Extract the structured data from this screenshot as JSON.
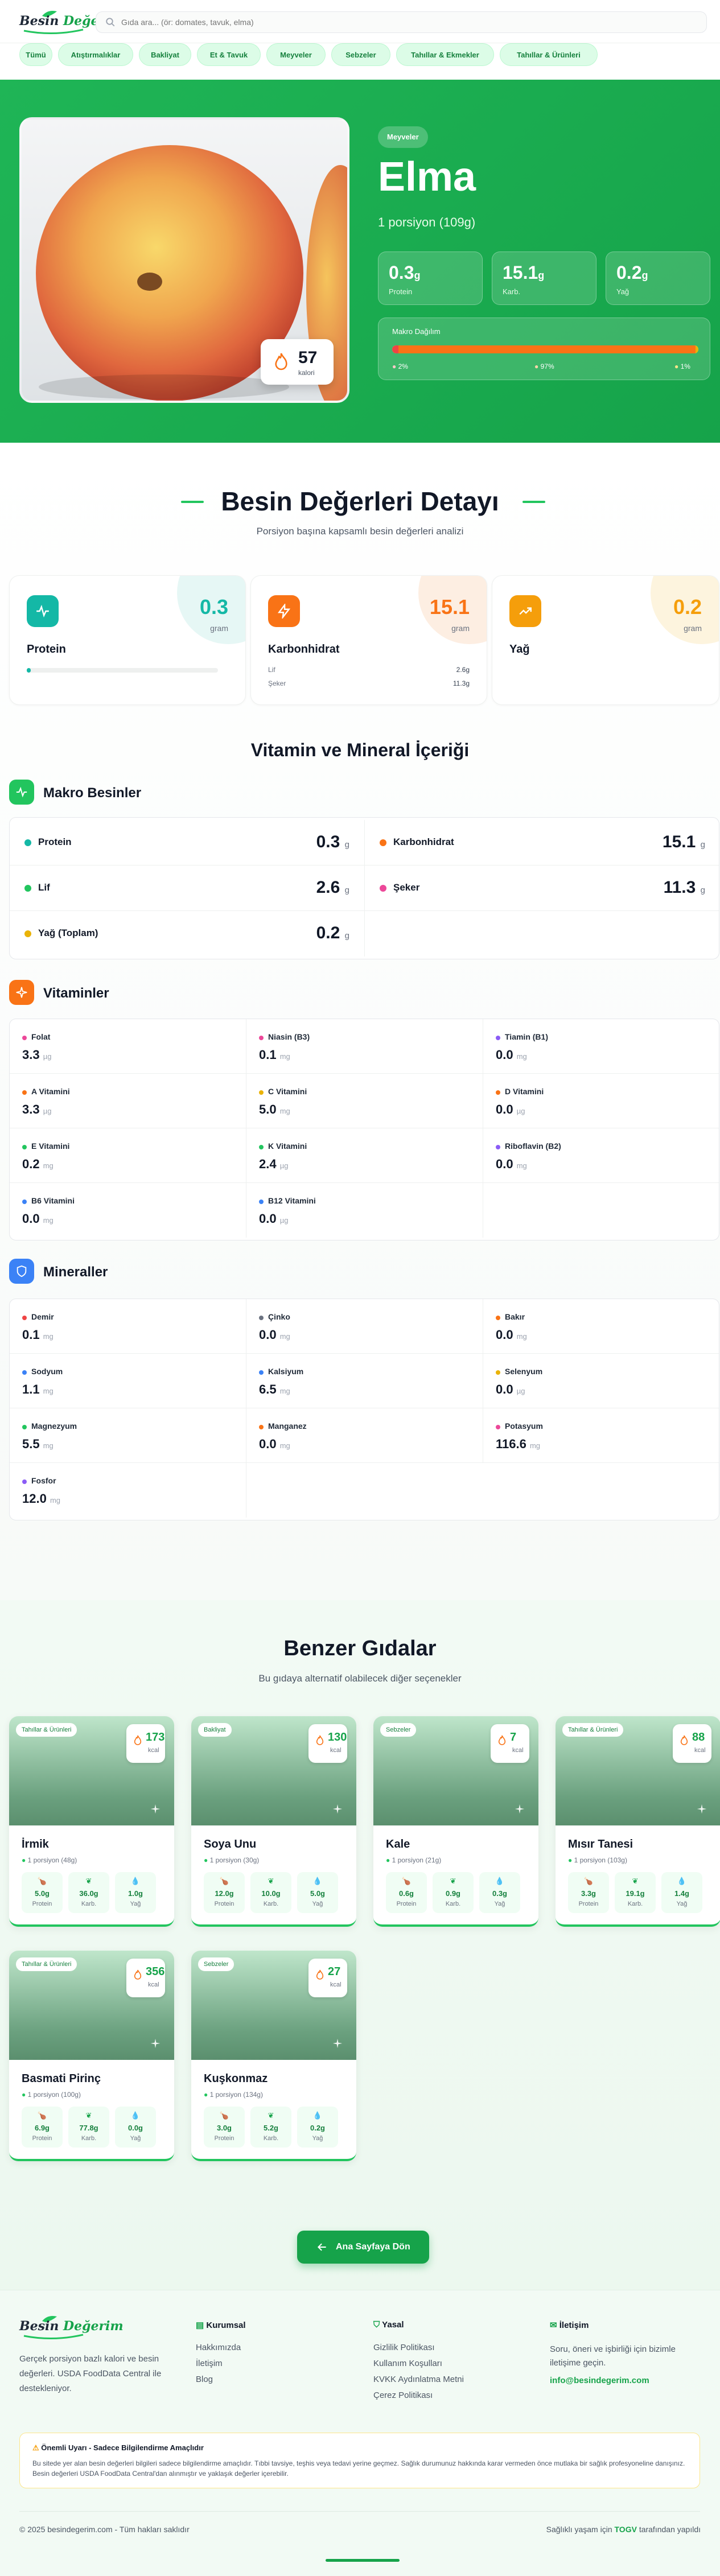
{
  "header": {
    "logo_text_a": "Besin",
    "logo_text_b": "Değerim",
    "search_placeholder": "Gıda ara... (ör: domates, tavuk, elma)"
  },
  "categories": [
    "Tümü",
    "Atıştırmalıklar",
    "Bakliyat",
    "Et & Tavuk",
    "Meyveler",
    "Sebzeler",
    "Tahıllar & Ekmekler",
    "Tahıllar & Ürünleri"
  ],
  "hero": {
    "category": "Meyveler",
    "title": "Elma",
    "portion": "1 porsiyon (109g)",
    "calories": "57",
    "calories_label": "kalori",
    "macros": [
      {
        "value": "0.3",
        "unit": "g",
        "label": "Protein"
      },
      {
        "value": "15.1",
        "unit": "g",
        "label": "Karb."
      },
      {
        "value": "0.2",
        "unit": "g",
        "label": "Yağ"
      }
    ],
    "distribution_title": "Makro Dağılım",
    "distribution": [
      {
        "label": "2%",
        "percent": 2,
        "color": "#ef4444"
      },
      {
        "label": "97%",
        "percent": 97,
        "color": "#f97316"
      },
      {
        "label": "1%",
        "percent": 1,
        "color": "#eab308"
      }
    ]
  },
  "details": {
    "title": "Besin Değerleri Detayı",
    "subtitle": "Porsiyon başına kapsamlı besin değerleri analizi",
    "cards": [
      {
        "name": "Protein",
        "value": "0.3",
        "unit": "gram",
        "color": "#14b8a6",
        "icon": "activity-icon",
        "progress": 2
      },
      {
        "name": "Karbonhidrat",
        "value": "15.1",
        "unit": "gram",
        "color": "#f97316",
        "icon": "lightning-icon",
        "sub": [
          {
            "label": "Lif",
            "value": "2.6g"
          },
          {
            "label": "Şeker",
            "value": "11.3g"
          }
        ]
      },
      {
        "name": "Yağ",
        "value": "0.2",
        "unit": "gram",
        "color": "#f59e0b",
        "icon": "trend-up-icon"
      }
    ]
  },
  "vitmin": {
    "title": "Vitamin ve Mineral İçeriği",
    "macro_title": "Makro Besinler",
    "macro": [
      {
        "name": "Protein",
        "value": "0.3",
        "unit": "g",
        "color": "#14b8a6"
      },
      {
        "name": "Karbonhidrat",
        "value": "15.1",
        "unit": "g",
        "color": "#f97316"
      },
      {
        "name": "Lif",
        "value": "2.6",
        "unit": "g",
        "color": "#22c55e"
      },
      {
        "name": "Şeker",
        "value": "11.3",
        "unit": "g",
        "color": "#ec4899"
      },
      {
        "name": "Yağ (Toplam)",
        "value": "0.2",
        "unit": "g",
        "color": "#eab308"
      }
    ],
    "vitamins_title": "Vitaminler",
    "vitamins": [
      {
        "name": "Folat",
        "value": "3.3",
        "unit": "µg",
        "color": "#ec4899"
      },
      {
        "name": "Niasin (B3)",
        "value": "0.1",
        "unit": "mg",
        "color": "#ec4899"
      },
      {
        "name": "Tiamin (B1)",
        "value": "0.0",
        "unit": "mg",
        "color": "#8b5cf6"
      },
      {
        "name": "A Vitamini",
        "value": "3.3",
        "unit": "µg",
        "color": "#f97316"
      },
      {
        "name": "C Vitamini",
        "value": "5.0",
        "unit": "mg",
        "color": "#eab308"
      },
      {
        "name": "D Vitamini",
        "value": "0.0",
        "unit": "µg",
        "color": "#f97316"
      },
      {
        "name": "E Vitamini",
        "value": "0.2",
        "unit": "mg",
        "color": "#22c55e"
      },
      {
        "name": "K Vitamini",
        "value": "2.4",
        "unit": "µg",
        "color": "#22c55e"
      },
      {
        "name": "Riboflavin (B2)",
        "value": "0.0",
        "unit": "mg",
        "color": "#8b5cf6"
      },
      {
        "name": "B6 Vitamini",
        "value": "0.0",
        "unit": "mg",
        "color": "#3b82f6"
      },
      {
        "name": "B12 Vitamini",
        "value": "0.0",
        "unit": "µg",
        "color": "#3b82f6"
      }
    ],
    "minerals_title": "Mineraller",
    "minerals": [
      {
        "name": "Demir",
        "value": "0.1",
        "unit": "mg",
        "color": "#ef4444"
      },
      {
        "name": "Çinko",
        "value": "0.0",
        "unit": "mg",
        "color": "#6b7280"
      },
      {
        "name": "Bakır",
        "value": "0.0",
        "unit": "mg",
        "color": "#f97316"
      },
      {
        "name": "Sodyum",
        "value": "1.1",
        "unit": "mg",
        "color": "#3b82f6"
      },
      {
        "name": "Kalsiyum",
        "value": "6.5",
        "unit": "mg",
        "color": "#3b82f6"
      },
      {
        "name": "Selenyum",
        "value": "0.0",
        "unit": "µg",
        "color": "#eab308"
      },
      {
        "name": "Magnezyum",
        "value": "5.5",
        "unit": "mg",
        "color": "#22c55e"
      },
      {
        "name": "Manganez",
        "value": "0.0",
        "unit": "mg",
        "color": "#f97316"
      },
      {
        "name": "Potasyum",
        "value": "116.6",
        "unit": "mg",
        "color": "#ec4899"
      },
      {
        "name": "Fosfor",
        "value": "12.0",
        "unit": "mg",
        "color": "#8b5cf6"
      }
    ]
  },
  "similar": {
    "title": "Benzer Gıdalar",
    "subtitle": "Bu gıdaya alternatif olabilecek diğer seçenekler",
    "kcal_unit": "kcal",
    "macro_labels": [
      "Protein",
      "Karb.",
      "Yağ"
    ],
    "items": [
      {
        "category": "Tahıllar & Ürünleri",
        "name": "İrmik",
        "kcal": "173",
        "portion": "1 porsiyon (48g)",
        "protein": "5.0g",
        "carb": "36.0g",
        "fat": "1.0g"
      },
      {
        "category": "Bakliyat",
        "name": "Soya Unu",
        "kcal": "130",
        "portion": "1 porsiyon (30g)",
        "protein": "12.0g",
        "carb": "10.0g",
        "fat": "5.0g"
      },
      {
        "category": "Sebzeler",
        "name": "Kale",
        "kcal": "7",
        "portion": "1 porsiyon (21g)",
        "protein": "0.6g",
        "carb": "0.9g",
        "fat": "0.3g"
      },
      {
        "category": "Tahıllar & Ürünleri",
        "name": "Mısır Tanesi",
        "kcal": "88",
        "portion": "1 porsiyon (103g)",
        "protein": "3.3g",
        "carb": "19.1g",
        "fat": "1.4g"
      },
      {
        "category": "Tahıllar & Ürünleri",
        "name": "Basmati Pirinç",
        "kcal": "356",
        "portion": "1 porsiyon (100g)",
        "protein": "6.9g",
        "carb": "77.8g",
        "fat": "0.0g"
      },
      {
        "category": "Sebzeler",
        "name": "Kuşkonmaz",
        "kcal": "27",
        "portion": "1 porsiyon (134g)",
        "protein": "3.0g",
        "carb": "5.2g",
        "fat": "0.2g"
      }
    ],
    "home_button": "Ana Sayfaya Dön"
  },
  "footer": {
    "description": "Gerçek porsiyon bazlı kalori ve besin değerleri. USDA FoodData Central ile destekleniyor.",
    "corporate_title": "Kurumsal",
    "corporate_links": [
      "Hakkımızda",
      "İletişim",
      "Blog"
    ],
    "legal_title": "Yasal",
    "legal_links": [
      "Gizlilik Politikası",
      "Kullanım Koşulları",
      "KVKK Aydınlatma Metni",
      "Çerez Politikası"
    ],
    "contact_title": "İletişim",
    "contact_text": "Soru, öneri ve işbirliği için bizimle iletişime geçin.",
    "contact_email": "info@besindegerim.com",
    "warning_title": "Önemli Uyarı - Sadece Bilgilendirme Amaçlıdır",
    "warning_text": "Bu sitede yer alan besin değerleri bilgileri sadece bilgilendirme amaçlıdır. Tıbbi tavsiye, teşhis veya tedavi yerine geçmez. Sağlık durumunuz hakkında karar vermeden önce mutlaka bir sağlık profesyoneline danışınız. Besin değerleri USDA FoodData Central'dan alınmıştır ve yaklaşık değerler içerebilir.",
    "copyright": "© 2025 besindegerim.com - Tüm hakları saklıdır",
    "tagline_a": "Sağlıklı yaşam için",
    "tagline_b": "TOGV",
    "tagline_c": "tarafından yapıldı"
  }
}
